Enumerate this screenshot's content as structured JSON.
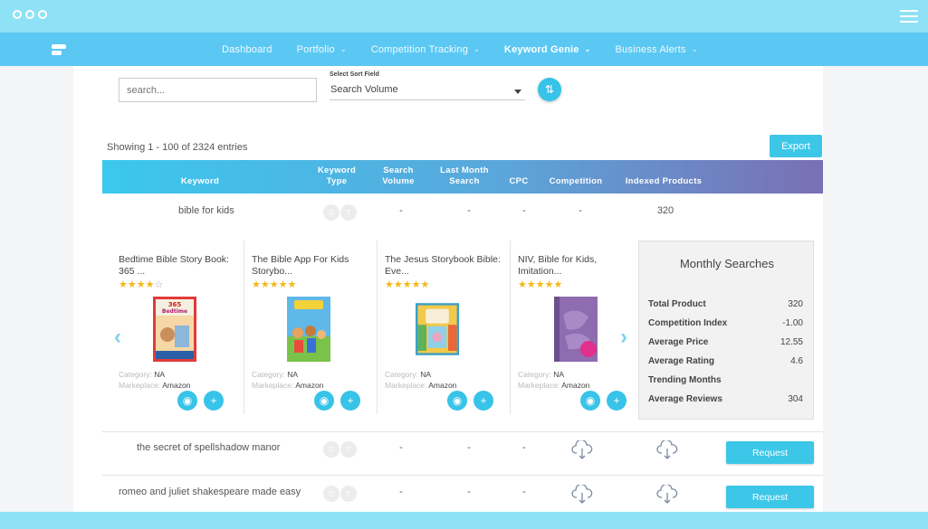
{
  "nav": {
    "items": [
      {
        "label": "Dashboard",
        "dropdown": false,
        "active": false
      },
      {
        "label": "Portfolio",
        "dropdown": true,
        "active": false
      },
      {
        "label": "Competition Tracking",
        "dropdown": true,
        "active": false
      },
      {
        "label": "Keyword Genie",
        "dropdown": true,
        "active": true
      },
      {
        "label": "Business Alerts",
        "dropdown": true,
        "active": false
      }
    ]
  },
  "controls": {
    "search_placeholder": "search...",
    "sort_label": "Select Sort Field",
    "sort_value": "Search Volume",
    "showing": "Showing 1 - 100 of 2324 entries",
    "export_label": "Export"
  },
  "table": {
    "headers": [
      "Keyword",
      "Keyword Type",
      "Search Volume",
      "Last Month Search",
      "CPC",
      "Competition",
      "Indexed Products"
    ],
    "type_badges": [
      "D",
      "T"
    ],
    "rows": [
      {
        "keyword": "bible for kids",
        "search_volume": "-",
        "last_month": "-",
        "cpc": "-",
        "competition": "-",
        "indexed": "320"
      },
      {
        "keyword": "the secret of spellshadow manor",
        "search_volume": "-",
        "last_month": "-",
        "cpc": "-",
        "action": "Request"
      },
      {
        "keyword": "romeo and juliet shakespeare made easy",
        "search_volume": "-",
        "last_month": "-",
        "cpc": "-",
        "action": "Request"
      }
    ]
  },
  "products": [
    {
      "title": "Bedtime Bible Story Book: 365 ...",
      "rating": 4,
      "category_label": "Category:",
      "category": "NA",
      "marketplace_label": "Markeplace:",
      "marketplace": "Amazon"
    },
    {
      "title": "The Bible App For Kids Storybo...",
      "rating": 5,
      "category_label": "Category:",
      "category": "NA",
      "marketplace_label": "Markeplace:",
      "marketplace": "Amazon"
    },
    {
      "title": "The Jesus Storybook Bible: Eve...",
      "rating": 5,
      "category_label": "Category:",
      "category": "NA",
      "marketplace_label": "Markeplace:",
      "marketplace": "Amazon"
    },
    {
      "title": "NIV, Bible for Kids, Imitation...",
      "rating": 5,
      "category_label": "Category:",
      "category": "NA",
      "marketplace_label": "Markeplace:",
      "marketplace": "Amazon"
    }
  ],
  "monthly": {
    "title": "Monthly Searches",
    "stats": [
      {
        "label": "Total Product",
        "value": "320"
      },
      {
        "label": "Competition Index",
        "value": "-1.00"
      },
      {
        "label": "Average Price",
        "value": "12.55"
      },
      {
        "label": "Average Rating",
        "value": "4.6"
      },
      {
        "label": "Trending Months",
        "value": ""
      },
      {
        "label": "Average Reviews",
        "value": "304"
      }
    ]
  },
  "colors": {
    "accent": "#3cc7e8",
    "nav_bg": "#5bc8f3",
    "frame": "#8fe1f5",
    "star": "#f3b814"
  }
}
